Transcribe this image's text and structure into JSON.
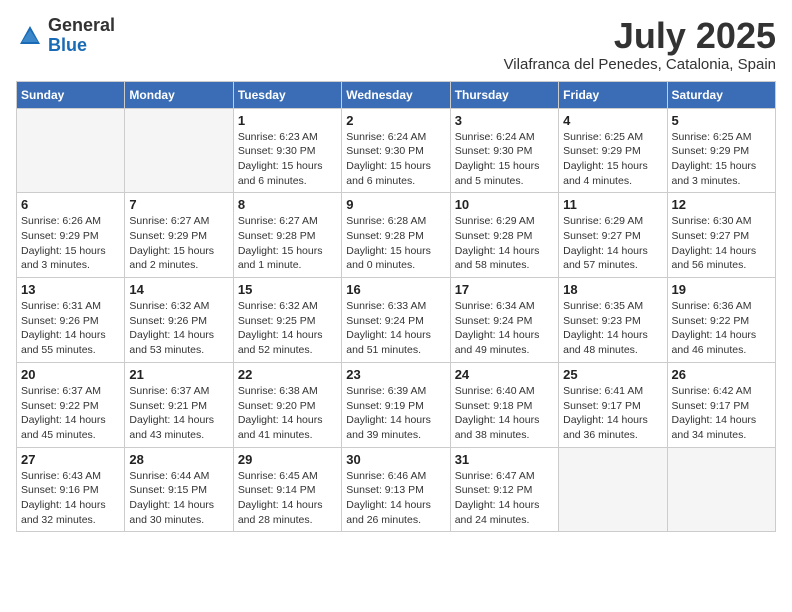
{
  "header": {
    "logo_general": "General",
    "logo_blue": "Blue",
    "month": "July 2025",
    "location": "Vilafranca del Penedes, Catalonia, Spain"
  },
  "weekdays": [
    "Sunday",
    "Monday",
    "Tuesday",
    "Wednesday",
    "Thursday",
    "Friday",
    "Saturday"
  ],
  "weeks": [
    [
      {
        "day": "",
        "info": ""
      },
      {
        "day": "",
        "info": ""
      },
      {
        "day": "1",
        "info": "Sunrise: 6:23 AM\nSunset: 9:30 PM\nDaylight: 15 hours and 6 minutes."
      },
      {
        "day": "2",
        "info": "Sunrise: 6:24 AM\nSunset: 9:30 PM\nDaylight: 15 hours and 6 minutes."
      },
      {
        "day": "3",
        "info": "Sunrise: 6:24 AM\nSunset: 9:30 PM\nDaylight: 15 hours and 5 minutes."
      },
      {
        "day": "4",
        "info": "Sunrise: 6:25 AM\nSunset: 9:29 PM\nDaylight: 15 hours and 4 minutes."
      },
      {
        "day": "5",
        "info": "Sunrise: 6:25 AM\nSunset: 9:29 PM\nDaylight: 15 hours and 3 minutes."
      }
    ],
    [
      {
        "day": "6",
        "info": "Sunrise: 6:26 AM\nSunset: 9:29 PM\nDaylight: 15 hours and 3 minutes."
      },
      {
        "day": "7",
        "info": "Sunrise: 6:27 AM\nSunset: 9:29 PM\nDaylight: 15 hours and 2 minutes."
      },
      {
        "day": "8",
        "info": "Sunrise: 6:27 AM\nSunset: 9:28 PM\nDaylight: 15 hours and 1 minute."
      },
      {
        "day": "9",
        "info": "Sunrise: 6:28 AM\nSunset: 9:28 PM\nDaylight: 15 hours and 0 minutes."
      },
      {
        "day": "10",
        "info": "Sunrise: 6:29 AM\nSunset: 9:28 PM\nDaylight: 14 hours and 58 minutes."
      },
      {
        "day": "11",
        "info": "Sunrise: 6:29 AM\nSunset: 9:27 PM\nDaylight: 14 hours and 57 minutes."
      },
      {
        "day": "12",
        "info": "Sunrise: 6:30 AM\nSunset: 9:27 PM\nDaylight: 14 hours and 56 minutes."
      }
    ],
    [
      {
        "day": "13",
        "info": "Sunrise: 6:31 AM\nSunset: 9:26 PM\nDaylight: 14 hours and 55 minutes."
      },
      {
        "day": "14",
        "info": "Sunrise: 6:32 AM\nSunset: 9:26 PM\nDaylight: 14 hours and 53 minutes."
      },
      {
        "day": "15",
        "info": "Sunrise: 6:32 AM\nSunset: 9:25 PM\nDaylight: 14 hours and 52 minutes."
      },
      {
        "day": "16",
        "info": "Sunrise: 6:33 AM\nSunset: 9:24 PM\nDaylight: 14 hours and 51 minutes."
      },
      {
        "day": "17",
        "info": "Sunrise: 6:34 AM\nSunset: 9:24 PM\nDaylight: 14 hours and 49 minutes."
      },
      {
        "day": "18",
        "info": "Sunrise: 6:35 AM\nSunset: 9:23 PM\nDaylight: 14 hours and 48 minutes."
      },
      {
        "day": "19",
        "info": "Sunrise: 6:36 AM\nSunset: 9:22 PM\nDaylight: 14 hours and 46 minutes."
      }
    ],
    [
      {
        "day": "20",
        "info": "Sunrise: 6:37 AM\nSunset: 9:22 PM\nDaylight: 14 hours and 45 minutes."
      },
      {
        "day": "21",
        "info": "Sunrise: 6:37 AM\nSunset: 9:21 PM\nDaylight: 14 hours and 43 minutes."
      },
      {
        "day": "22",
        "info": "Sunrise: 6:38 AM\nSunset: 9:20 PM\nDaylight: 14 hours and 41 minutes."
      },
      {
        "day": "23",
        "info": "Sunrise: 6:39 AM\nSunset: 9:19 PM\nDaylight: 14 hours and 39 minutes."
      },
      {
        "day": "24",
        "info": "Sunrise: 6:40 AM\nSunset: 9:18 PM\nDaylight: 14 hours and 38 minutes."
      },
      {
        "day": "25",
        "info": "Sunrise: 6:41 AM\nSunset: 9:17 PM\nDaylight: 14 hours and 36 minutes."
      },
      {
        "day": "26",
        "info": "Sunrise: 6:42 AM\nSunset: 9:17 PM\nDaylight: 14 hours and 34 minutes."
      }
    ],
    [
      {
        "day": "27",
        "info": "Sunrise: 6:43 AM\nSunset: 9:16 PM\nDaylight: 14 hours and 32 minutes."
      },
      {
        "day": "28",
        "info": "Sunrise: 6:44 AM\nSunset: 9:15 PM\nDaylight: 14 hours and 30 minutes."
      },
      {
        "day": "29",
        "info": "Sunrise: 6:45 AM\nSunset: 9:14 PM\nDaylight: 14 hours and 28 minutes."
      },
      {
        "day": "30",
        "info": "Sunrise: 6:46 AM\nSunset: 9:13 PM\nDaylight: 14 hours and 26 minutes."
      },
      {
        "day": "31",
        "info": "Sunrise: 6:47 AM\nSunset: 9:12 PM\nDaylight: 14 hours and 24 minutes."
      },
      {
        "day": "",
        "info": ""
      },
      {
        "day": "",
        "info": ""
      }
    ]
  ]
}
